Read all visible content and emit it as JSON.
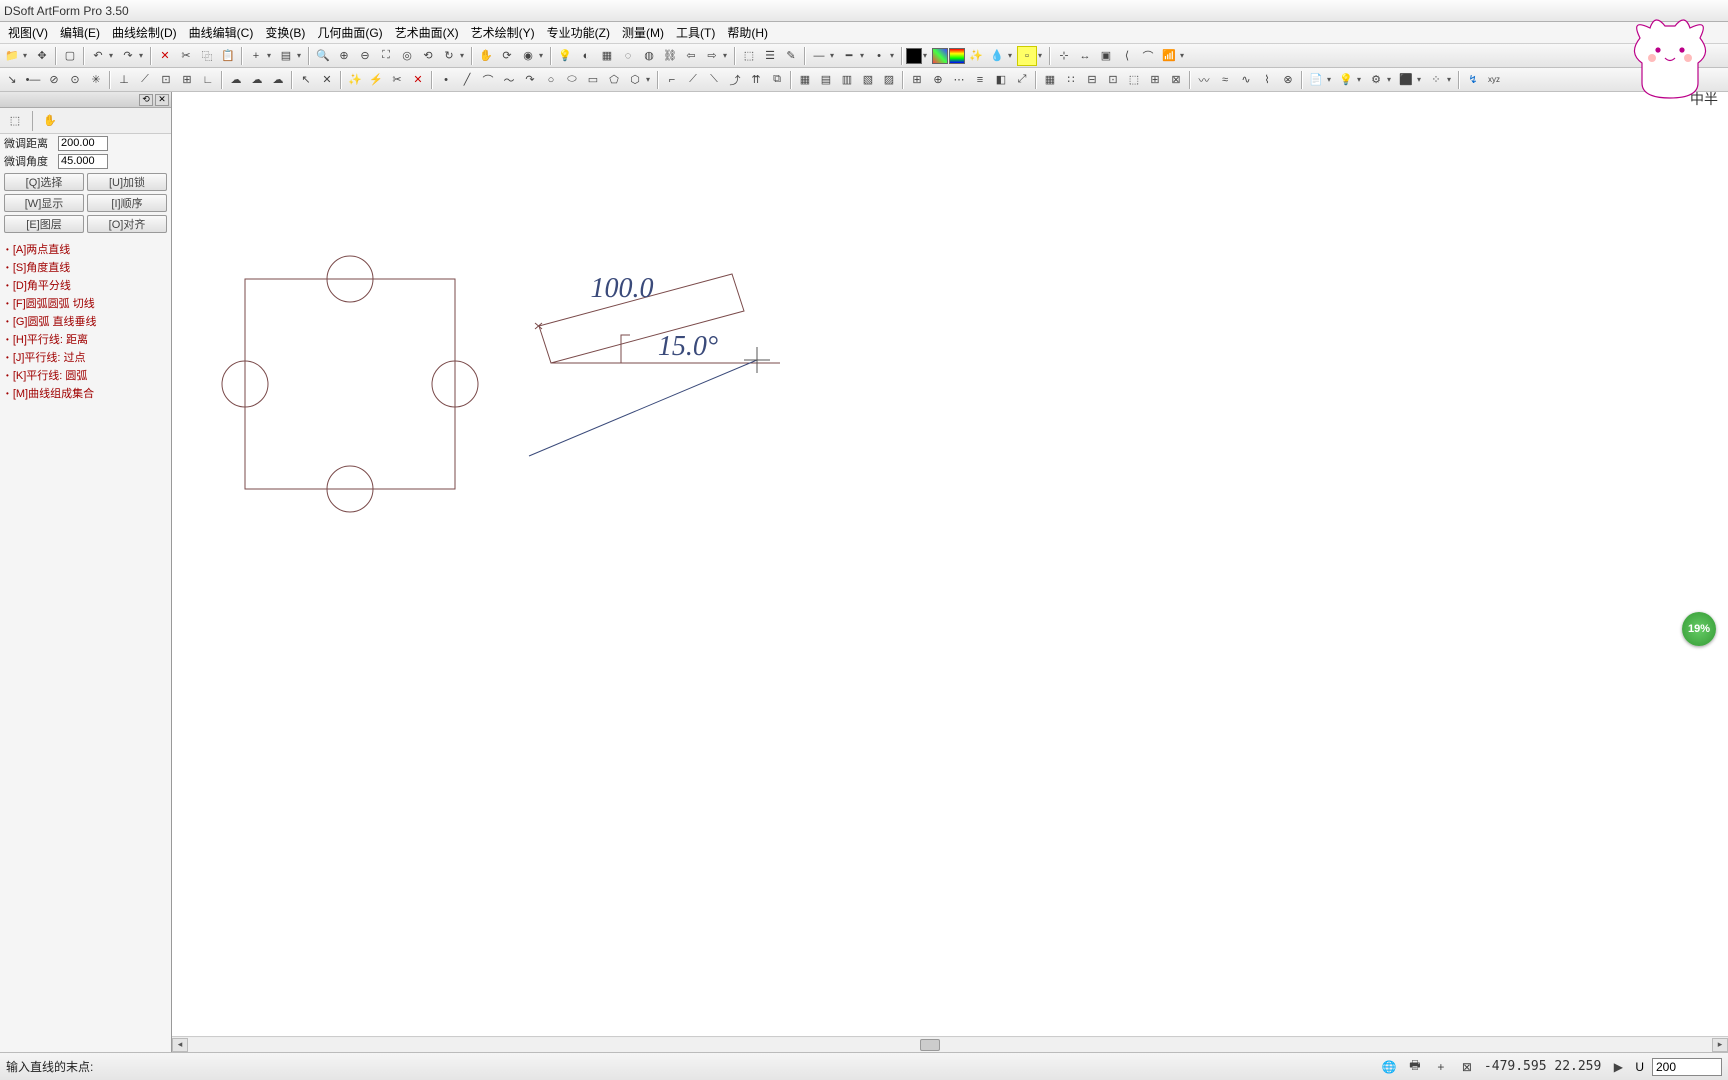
{
  "title": "DSoft ArtForm Pro 3.50",
  "menus": [
    "视图(V)",
    "编辑(E)",
    "曲线绘制(D)",
    "曲线编辑(C)",
    "变换(B)",
    "几何曲面(G)",
    "艺术曲面(X)",
    "艺术绘制(Y)",
    "专业功能(Z)",
    "测量(M)",
    "工具(T)",
    "帮助(H)"
  ],
  "sidebar": {
    "dist_label": "微调距离",
    "dist_value": "200.00",
    "angle_label": "微调角度",
    "angle_value": "45.000",
    "buttons": [
      "[Q]选择",
      "[U]加锁",
      "[W]显示",
      "[I]顺序",
      "[E]图层",
      "[O]对齐"
    ],
    "tools": [
      "[A]两点直线",
      "[S]角度直线",
      "[D]角平分线",
      "[F]圆弧圆弧 切线",
      "[G]圆弧 直线垂线",
      "[H]平行线: 距离",
      "[J]平行线: 过点",
      "[K]平行线: 圆弧",
      "[M]曲线组成集合"
    ]
  },
  "canvas": {
    "dim_length": "100.0",
    "angle_text": "15.0°"
  },
  "status": {
    "prompt": "输入直线的末点:",
    "coords": "-479.595 22.259",
    "u_label": "U",
    "u_val": "200"
  },
  "badge": "19%",
  "mascot_label": "中半",
  "colors": {
    "draw": "#7a4a4a",
    "ref": "#3a4a7a",
    "ui_border": "#888"
  }
}
